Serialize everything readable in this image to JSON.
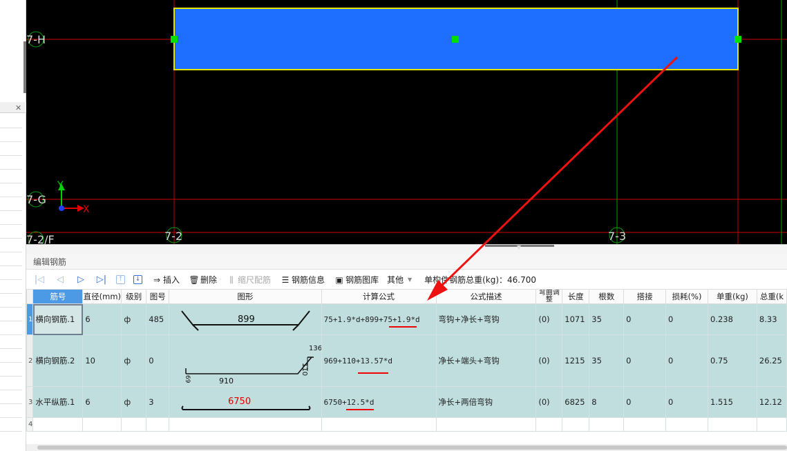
{
  "canvas": {
    "axis_labels": {
      "h7H": "7-H",
      "h7G": "7-G",
      "h72F": "7-2/F",
      "v72": "7-2",
      "v73": "7-3"
    },
    "ucs": {
      "y": "Y",
      "x": "X"
    },
    "colors": {
      "beam": "#1e6eff",
      "grip": "#00e000",
      "gridline": "#cc0000",
      "background": "#000000"
    }
  },
  "panel": {
    "title": "编辑钢筋"
  },
  "toolbar": {
    "nav_first_icon": "first-icon",
    "nav_prev_icon": "prev-icon",
    "nav_next_icon": "next-icon",
    "nav_last_icon": "last-icon",
    "move_up_icon": "move-up-icon",
    "move_down_icon": "move-down-icon",
    "insert": "插入",
    "delete": "删除",
    "scale": "缩尺配筋",
    "info": "钢筋信息",
    "library": "钢筋图库",
    "other": "其他",
    "total_weight": "单构件钢筋总重(kg)：46.700"
  },
  "table": {
    "headers": {
      "name": "筋号",
      "diameter": "直径(mm)",
      "grade": "级别",
      "figno": "图号",
      "shape": "图形",
      "formula": "计算公式",
      "desc": "公式描述",
      "bend": "弯曲调整",
      "length": "长度",
      "count": "根数",
      "lap": "搭接",
      "loss": "损耗(%)",
      "unit_weight": "单重(kg)",
      "total_weight": "总重(k"
    },
    "rows": [
      {
        "num": "1",
        "name": "横向钢筋.1",
        "diameter": "6",
        "grade": "ф",
        "figno": "485",
        "shape_label": "899",
        "formula": "75+1.9*d+899+75+1.9*d",
        "desc": "弯钩+净长+弯钩",
        "bend": "(0)",
        "length": "1071",
        "count": "35",
        "lap": "0",
        "loss": "0",
        "unit_weight": "0.238",
        "total_weight": "8.33"
      },
      {
        "num": "2",
        "name": "横向钢筋.2",
        "diameter": "10",
        "grade": "ф",
        "figno": "0",
        "shape_label_a": "136",
        "shape_label_b": "110",
        "shape_label_c": "910",
        "shape_label_d": "69",
        "formula": "969+110+13.57*d",
        "desc": "净长+端头+弯钩",
        "bend": "(0)",
        "length": "1215",
        "count": "35",
        "lap": "0",
        "loss": "0",
        "unit_weight": "0.75",
        "total_weight": "26.25"
      },
      {
        "num": "3",
        "name": "水平纵筋.1",
        "diameter": "6",
        "grade": "ф",
        "figno": "3",
        "shape_label": "6750",
        "formula": "6750+12.5*d",
        "desc": "净长+两倍弯钩",
        "bend": "(0)",
        "length": "6825",
        "count": "8",
        "lap": "0",
        "loss": "0",
        "unit_weight": "1.515",
        "total_weight": "12.12"
      }
    ],
    "empty_row_num": "4"
  }
}
